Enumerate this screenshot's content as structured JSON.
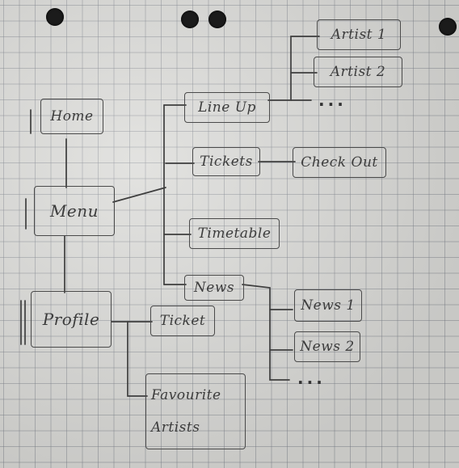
{
  "nodes": {
    "home": "Home",
    "menu": "Menu",
    "profile": "Profile",
    "line_up": "Line Up",
    "tickets": "Tickets",
    "check_out": "Check Out",
    "timetable": "Timetable",
    "news": "News",
    "ticket": "Ticket",
    "favourite_artists": [
      "Favourite",
      "Artists"
    ],
    "artist_1": "Artist 1",
    "artist_2": "Artist 2",
    "news_1": "News 1",
    "news_2": "News 2"
  },
  "ellipsis": "...",
  "colors": {
    "paper": "#d9d9d6",
    "grid": "#7d8087",
    "ink": "#3c3c3c"
  }
}
